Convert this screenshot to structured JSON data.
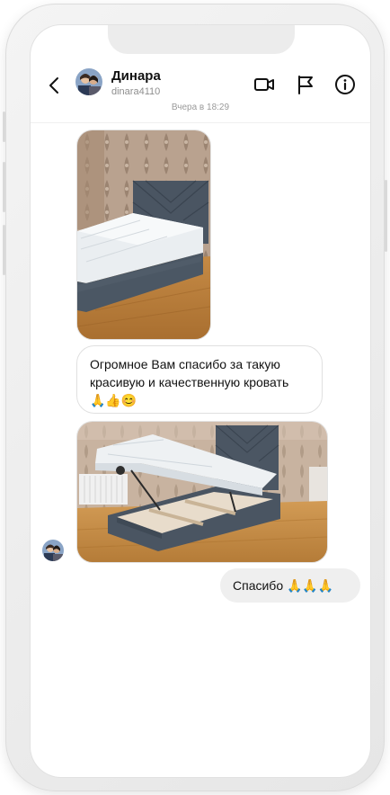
{
  "header": {
    "name": "Динара",
    "username": "dinara4110"
  },
  "timestamp": "Вчера в 18:29",
  "messages": {
    "text_line1": "Огромное Вам спасибо за такую",
    "text_line2": "красивую и качественную кровать",
    "text_emoji": "🙏👍😊",
    "reply_text": "Спасибо",
    "reply_emoji": "🙏🙏🙏"
  },
  "icons": {
    "back": "chevron-left-icon",
    "video": "video-camera-icon",
    "flag": "flag-icon",
    "info": "info-icon"
  }
}
